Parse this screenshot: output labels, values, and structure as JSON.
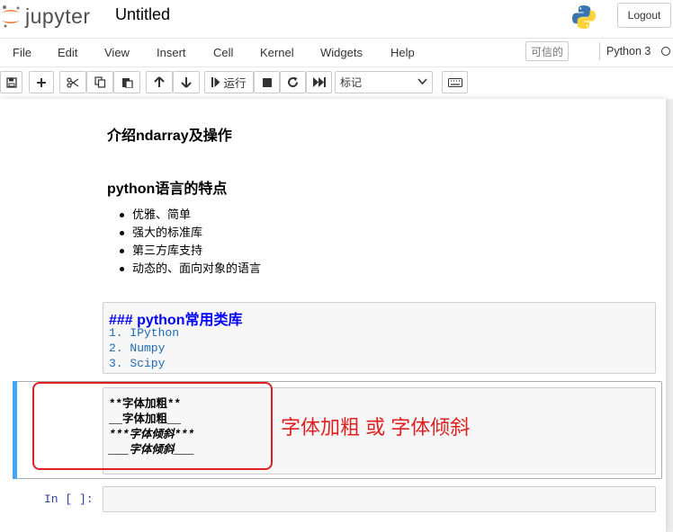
{
  "header": {
    "logo_text": "jupyter",
    "notebook_title": "Untitled",
    "logout_label": "Logout"
  },
  "menu": {
    "items": [
      "File",
      "Edit",
      "View",
      "Insert",
      "Cell",
      "Kernel",
      "Widgets",
      "Help"
    ],
    "trusted_label": "可信的",
    "kernel_name": "Python 3"
  },
  "toolbar": {
    "run_label": "运行",
    "cell_type": "标记",
    "icons": [
      "save-icon",
      "plus-icon",
      "cut-icon",
      "copy-icon",
      "paste-icon",
      "arrow-up-icon",
      "arrow-down-icon",
      "run-icon",
      "stop-icon",
      "restart-icon",
      "fast-forward-icon",
      "keyboard-icon"
    ]
  },
  "cells": {
    "heading1": "介绍ndarray及操作",
    "heading2": "python语言的特点",
    "list": [
      "优雅、简单",
      "强大的标准库",
      "第三方库支持",
      "动态的、面向对象的语言"
    ],
    "raw_cell": {
      "heading": "### python常用类库",
      "lines": [
        "1. IPython",
        "2. Numpy",
        "3. Scipy"
      ]
    },
    "selected_cell": {
      "lines": [
        "**字体加粗**",
        "__字体加粗__",
        "***字体倾斜***",
        "___字体倾斜___"
      ]
    },
    "input_prompt": "In [ ]:"
  },
  "annotation": {
    "text": "字体加粗 或 字体倾斜",
    "color": "#e02020"
  },
  "colors": {
    "selection_bar": "#42a5f5",
    "heading_markdown": "#0000ff",
    "list_markdown": "#1c6ab3"
  }
}
